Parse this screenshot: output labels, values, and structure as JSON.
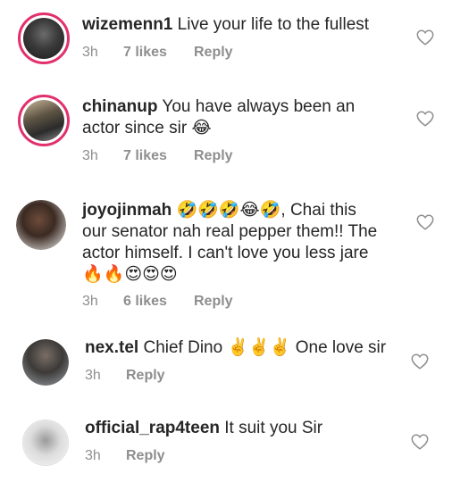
{
  "comments": [
    {
      "username": "wizemenn1",
      "text": "Live your life to the fullest",
      "time": "3h",
      "likes": "7 likes",
      "reply": "Reply"
    },
    {
      "username": "chinanup",
      "text": "You have always been an",
      "text2": "actor since sir 😂",
      "time": "3h",
      "likes": "7 likes",
      "reply": "Reply"
    },
    {
      "username": "joyojinmah",
      "text": "🤣🤣🤣😂🤣, Chai this",
      "text2": "our senator nah real pepper them!! The",
      "text3": "actor himself. I can't love you less jare",
      "text4": "🔥🔥😍😍😍",
      "time": "3h",
      "likes": "6 likes",
      "reply": "Reply"
    },
    {
      "username": "nex.tel",
      "text": "Chief Dino ✌️✌️✌️ One love sir",
      "time": "3h",
      "reply": "Reply"
    },
    {
      "username": "official_rap4teen",
      "text": "It suit you Sir",
      "time": "3h",
      "reply": "Reply"
    }
  ],
  "icons": {
    "like": "heart-outline-icon"
  },
  "colors": {
    "story_ring": "#e1306c",
    "meta": "#8e8e8e",
    "text": "#262626"
  }
}
